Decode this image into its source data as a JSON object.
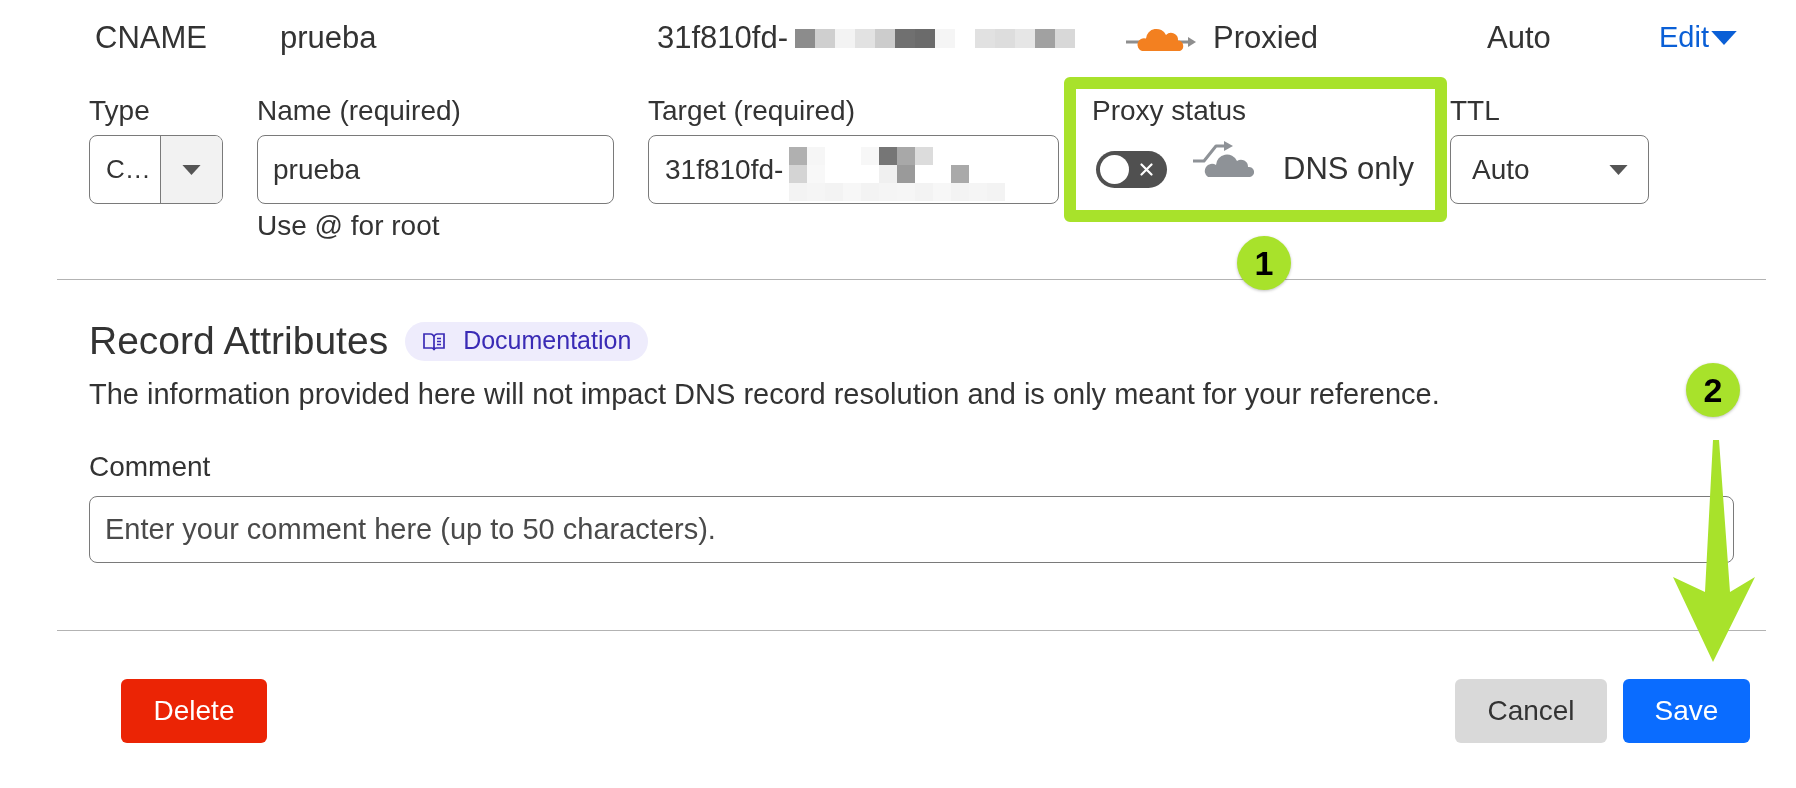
{
  "record_row": {
    "type": "CNAME",
    "name": "prueba",
    "content": "31f810fd-",
    "content_redacted": true,
    "proxied": true,
    "proxy_status": "Proxied",
    "ttl": "Auto",
    "action": "Edit"
  },
  "edit_form": {
    "type": {
      "label": "Type",
      "value": "C…"
    },
    "name": {
      "label": "Name (required)",
      "value": "prueba",
      "hint": "Use @ for root"
    },
    "target": {
      "label": "Target (required)",
      "value": "31f810fd-",
      "redacted": true
    },
    "proxy_status": {
      "label": "Proxy status",
      "on": false,
      "status": "DNS only"
    },
    "ttl": {
      "label": "TTL",
      "value": "Auto"
    }
  },
  "record_attributes": {
    "title": "Record Attributes",
    "documentation_link": "Documentation",
    "description": "The information provided here will not impact DNS record resolution and is only meant for your reference.",
    "comment": {
      "label": "Comment",
      "placeholder": "Enter your comment here (up to 50 characters)."
    }
  },
  "buttons": [
    {
      "label": "Delete",
      "kind": "danger"
    },
    {
      "label": "Cancel",
      "kind": "secondary"
    },
    {
      "label": "Save",
      "kind": "primary"
    }
  ],
  "annotations": [
    {
      "number": "1",
      "kind": "frame"
    },
    {
      "number": "2",
      "kind": "arrow"
    }
  ]
}
